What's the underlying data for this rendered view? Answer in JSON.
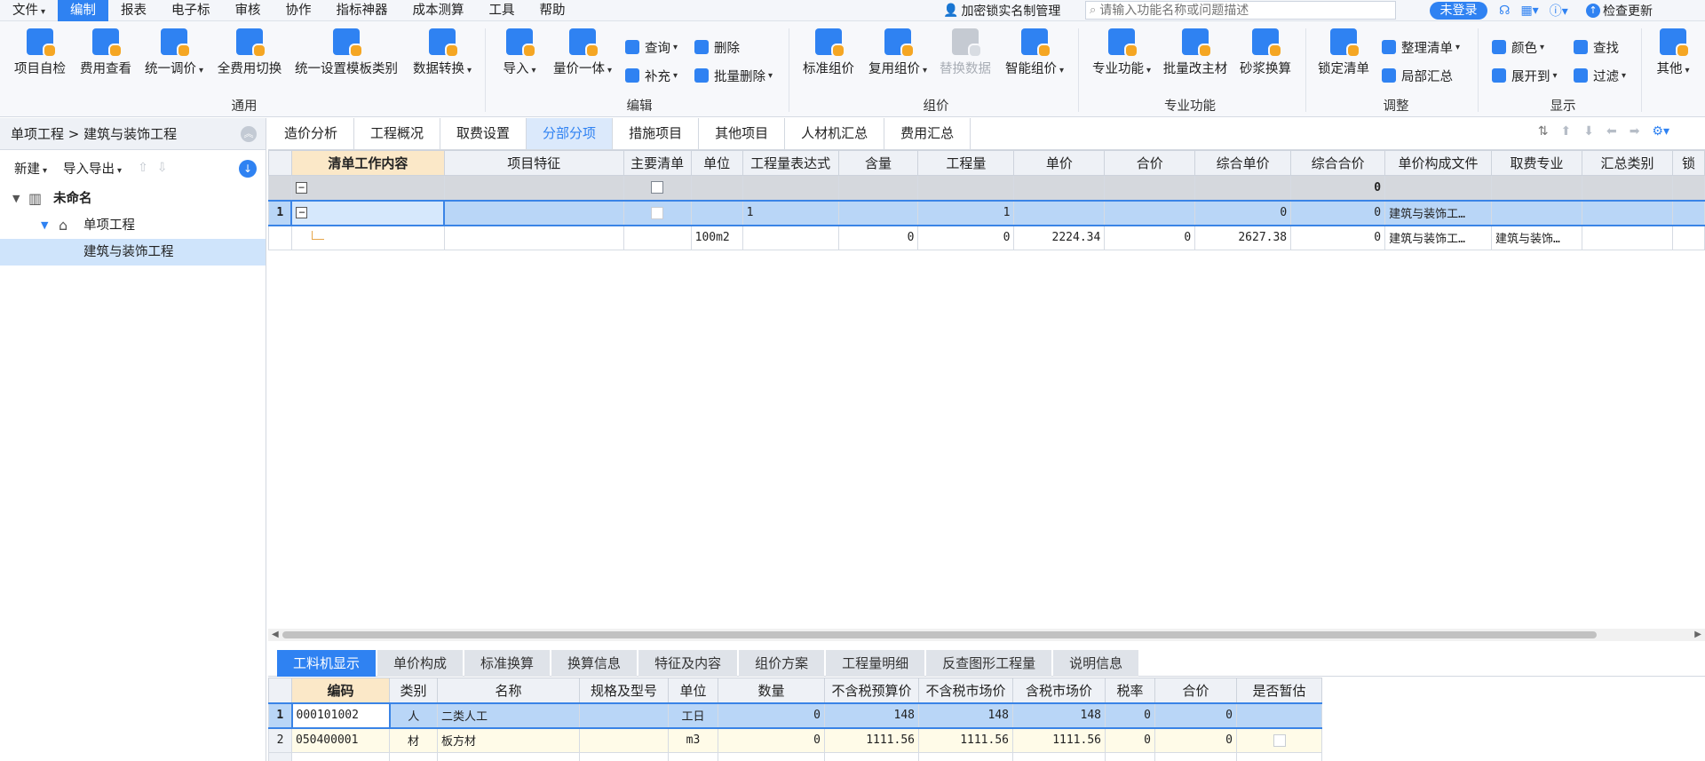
{
  "menu": {
    "items": [
      "文件",
      "编制",
      "报表",
      "电子标",
      "审核",
      "协作",
      "指标神器",
      "成本测算",
      "工具",
      "帮助"
    ],
    "active_index": 1,
    "dongle": "加密锁实名制管理",
    "search_placeholder": "请输入功能名称或问题描述",
    "login": "未登录",
    "update": "检查更新"
  },
  "ribbon": {
    "general": {
      "label": "通用",
      "buttons": [
        "项目自检",
        "费用查看",
        "统一调价",
        "全费用切换",
        "统一设置模板类别",
        "数据转换"
      ]
    },
    "edit": {
      "label": "编辑",
      "buttons": [
        "导入",
        "量价一体"
      ],
      "small": [
        "查询",
        "删除",
        "补充",
        "批量删除"
      ]
    },
    "pricing": {
      "label": "组价",
      "buttons": [
        "标准组价",
        "复用组价",
        "替换数据",
        "智能组价"
      ]
    },
    "special": {
      "label": "专业功能",
      "buttons": [
        "专业功能",
        "批量改主材",
        "砂浆换算"
      ]
    },
    "adjust": {
      "label": "调整",
      "buttons": [
        "锁定清单"
      ],
      "small": [
        "整理清单",
        "局部汇总"
      ]
    },
    "display": {
      "label": "显示",
      "small": [
        "颜色",
        "查找",
        "展开到",
        "过滤"
      ],
      "other": "其他"
    }
  },
  "left": {
    "breadcrumb": "单项工程 > 建筑与装饰工程",
    "tools": {
      "new": "新建",
      "import_export": "导入导出"
    },
    "tree": [
      {
        "label": "未命名",
        "level": 0
      },
      {
        "label": "单项工程",
        "level": 1
      },
      {
        "label": "建筑与装饰工程",
        "level": 2,
        "selected": true
      }
    ]
  },
  "tabs": {
    "items": [
      "造价分析",
      "工程概况",
      "取费设置",
      "分部分项",
      "措施项目",
      "其他项目",
      "人材机汇总",
      "费用汇总"
    ],
    "active_index": 3
  },
  "grid": {
    "columns": [
      "清单工作内容",
      "项目特征",
      "主要清单",
      "单位",
      "工程量表达式",
      "含量",
      "工程量",
      "单价",
      "合价",
      "综合单价",
      "综合合价",
      "单价构成文件",
      "取费专业",
      "汇总类别",
      "锁"
    ],
    "summary_value": "0",
    "row1": {
      "num": "1",
      "expr": "1",
      "qty": "1",
      "total_unit": "0",
      "total_sum": "0",
      "file": "建筑与装饰工…"
    },
    "row2": {
      "unit": "100m2",
      "content": "0",
      "qty": "0",
      "price": "2224.34",
      "sum": "0",
      "total_unit": "2627.38",
      "total_sum": "0",
      "file": "建筑与装饰工…",
      "spec": "建筑与装饰…"
    }
  },
  "bottom": {
    "tabs": [
      "工料机显示",
      "单价构成",
      "标准换算",
      "换算信息",
      "特征及内容",
      "组价方案",
      "工程量明细",
      "反查图形工程量",
      "说明信息"
    ],
    "active_index": 0,
    "columns": [
      "编码",
      "类别",
      "名称",
      "规格及型号",
      "单位",
      "数量",
      "不含税预算价",
      "不含税市场价",
      "含税市场价",
      "税率",
      "合价",
      "是否暂估"
    ],
    "rows": [
      {
        "num": "1",
        "code": "000101002",
        "type": "人",
        "name": "二类人工",
        "spec": "",
        "unit": "工日",
        "qty": "0",
        "budget": "148",
        "market": "148",
        "tax_market": "148",
        "rate": "0",
        "sum": "0"
      },
      {
        "num": "2",
        "code": "050400001",
        "type": "材",
        "name": "板方材",
        "spec": "",
        "unit": "m3",
        "qty": "0",
        "budget": "1111.56",
        "market": "1111.56",
        "tax_market": "1111.56",
        "rate": "0",
        "sum": "0"
      }
    ]
  },
  "colors": {
    "accent": "#2f82f2",
    "selected_row": "#b9d6f7",
    "header_highlight": "#fbe8c8"
  }
}
